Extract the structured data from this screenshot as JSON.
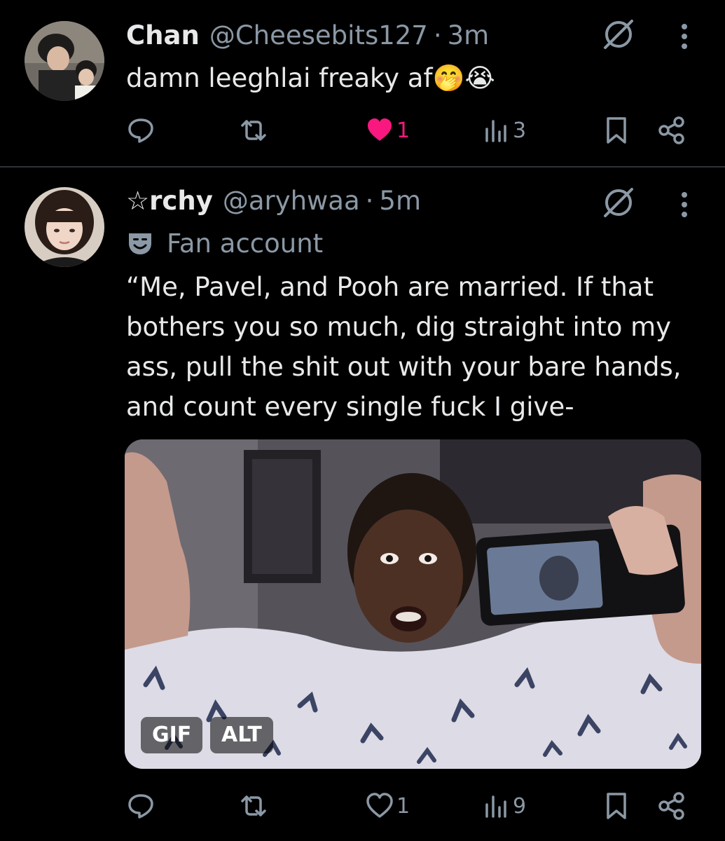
{
  "posts": [
    {
      "name": "Chan",
      "handle": "@Cheesebits127",
      "separator": "·",
      "time": "3m",
      "text": "damn leeghlai freaky af🤭😭",
      "stats": {
        "likes": "1",
        "views": "3"
      },
      "liked": true
    },
    {
      "name": "☆rchy",
      "handle": "@aryhwaa",
      "separator": "·",
      "time": "5m",
      "badge": "Fan account",
      "text": "“Me, Pavel, and Pooh are married. If that bothers you so much, dig straight into my ass, pull the shit out with your bare hands, and count every single fuck I give-",
      "media": {
        "gif_label": "GIF",
        "alt_label": "ALT"
      },
      "stats": {
        "likes": "1",
        "views": "9"
      },
      "liked": false
    }
  ],
  "colors": {
    "background": "#000000",
    "primary_text": "#e7e9ea",
    "secondary_text": "#8b98a5",
    "like_pink": "#f91880",
    "divider": "#2f3336"
  },
  "icons": [
    "reply-icon",
    "retweet-icon",
    "heart-icon",
    "views-icon",
    "bookmark-icon",
    "share-icon",
    "grok-icon",
    "more-icon",
    "mask-icon"
  ]
}
